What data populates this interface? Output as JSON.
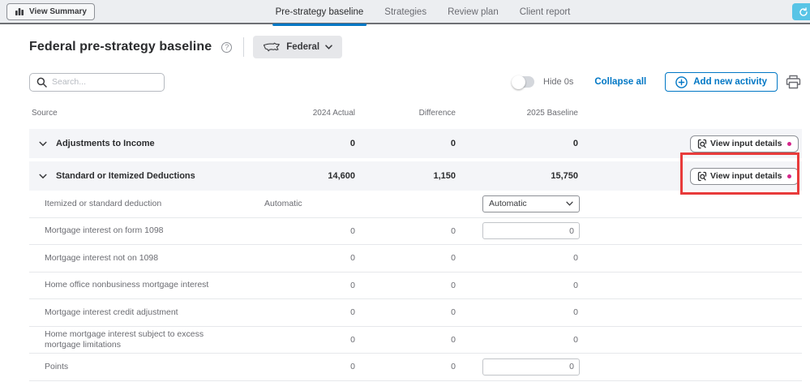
{
  "topbar": {
    "view_summary_label": "View Summary",
    "tabs": [
      {
        "label": "Pre-strategy baseline",
        "active": true
      },
      {
        "label": "Strategies",
        "active": false
      },
      {
        "label": "Review plan",
        "active": false
      },
      {
        "label": "Client report",
        "active": false
      }
    ]
  },
  "header": {
    "title": "Federal pre-strategy baseline",
    "jurisdiction": "Federal"
  },
  "toolbar": {
    "search_placeholder": "Search...",
    "hide_zeros_label": "Hide 0s",
    "collapse_all_label": "Collapse all",
    "add_activity_label": "Add new activity"
  },
  "table": {
    "columns": [
      "Source",
      "2024 Actual",
      "Difference",
      "2025 Baseline"
    ],
    "sections": [
      {
        "label": "Adjustments to Income",
        "actual": "0",
        "difference": "0",
        "baseline": "0",
        "button_label": "View input details"
      },
      {
        "label": "Standard or Itemized Deductions",
        "actual": "14,600",
        "difference": "1,150",
        "baseline": "15,750",
        "button_label": "View input details"
      }
    ],
    "rows": [
      {
        "label": "Itemized or standard deduction",
        "actual": "Automatic",
        "difference": "",
        "baseline": "Automatic"
      },
      {
        "label": "Mortgage interest on form 1098",
        "actual": "0",
        "difference": "0",
        "baseline": "0"
      },
      {
        "label": "Mortgage interest not on 1098",
        "actual": "0",
        "difference": "0",
        "baseline": "0"
      },
      {
        "label": "Home office nonbusiness mortgage interest",
        "actual": "0",
        "difference": "0",
        "baseline": "0"
      },
      {
        "label": "Mortgage interest credit adjustment",
        "actual": "0",
        "difference": "0",
        "baseline": "0"
      },
      {
        "label": "Home mortgage interest subject to excess mortgage limitations",
        "actual": "0",
        "difference": "0",
        "baseline": "0"
      },
      {
        "label": "Points",
        "actual": "0",
        "difference": "0",
        "baseline": "0"
      }
    ]
  },
  "colors": {
    "accent_blue": "#0077c5",
    "status_magenta": "#d5268a",
    "annotation_red": "#e83b3b",
    "section_row_bg": "#f4f5f8",
    "topbar_bg": "#eceef1",
    "float_button_blue": "#58c4e6"
  }
}
